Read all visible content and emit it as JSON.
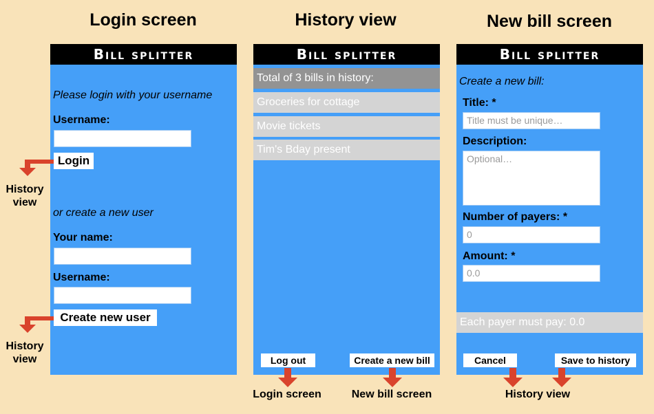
{
  "titles": {
    "login": "Login screen",
    "history": "History view",
    "newbill": "New bill screen"
  },
  "app_header": "Bill splitter",
  "login_screen": {
    "prompt": "Please login with your username",
    "username_label": "Username:",
    "username_value": "",
    "login_button": "Login",
    "create_prompt": "or create a new user",
    "your_name_label": "Your name:",
    "your_name_value": "",
    "username2_label": "Username:",
    "username2_value": "",
    "create_button": "Create new user"
  },
  "history_screen": {
    "header_row": "Total of 3 bills in history:",
    "bills": [
      "Groceries for cottage",
      "Movie tickets",
      "Tim's Bday present"
    ],
    "logout_button": "Log out",
    "new_bill_button": "Create a new bill"
  },
  "newbill_screen": {
    "heading": "Create a new bill:",
    "title_label": "Title: *",
    "title_placeholder": "Title must be unique…",
    "description_label": "Description:",
    "description_placeholder": "Optional…",
    "payers_label": "Number of payers: *",
    "payers_value": "0",
    "amount_label": "Amount: *",
    "amount_value": "0.0",
    "each_payer": "Each payer must pay: 0.0",
    "cancel_button": "Cancel",
    "save_button": "Save to history"
  },
  "arrows": {
    "login_to": "History view",
    "create_to": "History view",
    "logout_to": "Login screen",
    "newbill_to": "New bill screen",
    "cancel_save_to": "History view"
  },
  "colors": {
    "background": "#f9e3b9",
    "screen": "#459ff8",
    "arrow": "#d9432c",
    "list_row": "#d4d4d4",
    "list_header": "#939393"
  }
}
